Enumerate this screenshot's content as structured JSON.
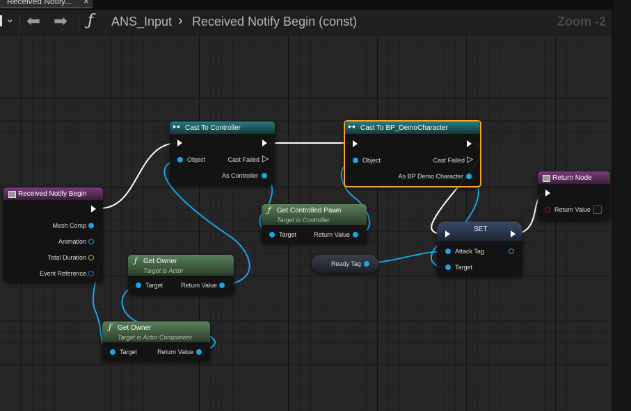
{
  "tab": {
    "label": "Received Notify..."
  },
  "toolbar": {
    "breadcrumb_root": "ANS_Input",
    "breadcrumb_current": "Received Notify Begin (const)",
    "zoom": "Zoom -2"
  },
  "nodes": {
    "received_notify_begin": {
      "title": "Received Notify Begin",
      "pins": [
        "Mesh Comp",
        "Animation",
        "Total Duration",
        "Event Reference"
      ]
    },
    "cast_to_controller": {
      "title": "Cast To Controller",
      "object": "Object",
      "cast_failed": "Cast Failed",
      "as_output": "As Controller"
    },
    "cast_to_character": {
      "title": "Cast To BP_DemoCharacter",
      "object": "Object",
      "cast_failed": "Cast Failed",
      "as_output": "As BP Demo Character"
    },
    "get_controlled_pawn": {
      "title": "Get Controlled Pawn",
      "subtitle": "Target is Controller",
      "target": "Target",
      "return_value": "Return Value"
    },
    "get_owner_actor": {
      "title": "Get Owner",
      "subtitle": "Target is Actor",
      "target": "Target",
      "return_value": "Return Value"
    },
    "get_owner_component": {
      "title": "Get Owner",
      "subtitle": "Target is Actor Component",
      "target": "Target",
      "return_value": "Return Value"
    },
    "set_node": {
      "title": "SET",
      "attack_tag": "Attack Tag",
      "target": "Target"
    },
    "ready_tag": {
      "label": "Ready Tag"
    },
    "return_node": {
      "title": "Return Node",
      "return_value": "Return Value"
    }
  },
  "colors": {
    "function_header": "#4a6b4a",
    "cast_header": "#1f5a5f",
    "event_header": "#6b2a6b",
    "data_wire": "#18a6e6",
    "exec_wire": "#ffffff",
    "selection": "#f5a623"
  }
}
